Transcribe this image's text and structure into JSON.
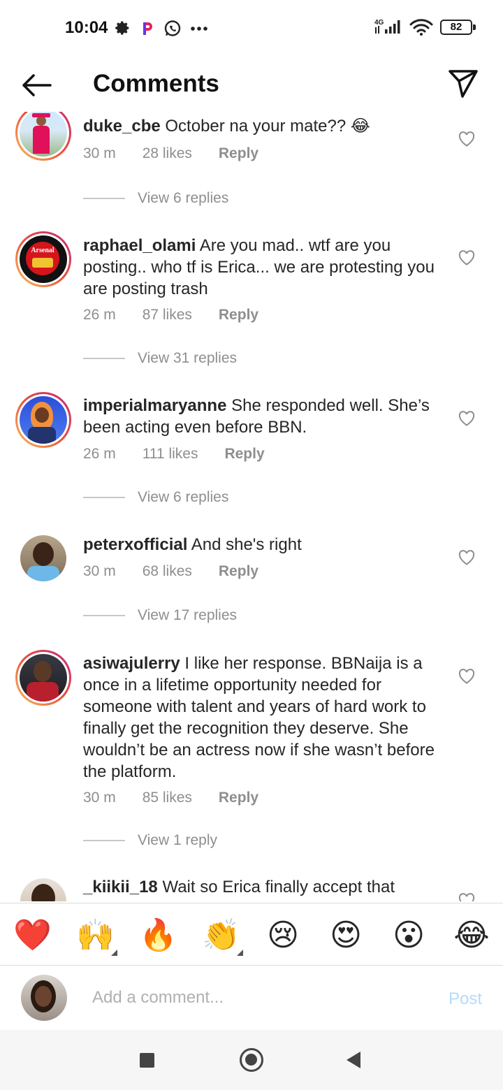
{
  "status_bar": {
    "time": "10:04",
    "network": "4G",
    "battery": "82",
    "left_icons": [
      "gear-icon",
      "p-app-icon",
      "whatsapp-icon",
      "more-dots-icon"
    ],
    "right_icons": [
      "signal-icon",
      "wifi-icon",
      "battery-icon"
    ]
  },
  "header": {
    "title": "Comments",
    "back_icon": "arrow-left-icon",
    "share_icon": "paper-plane-icon"
  },
  "comments": [
    {
      "username": "duke_cbe",
      "text": "October na your mate?? 😂",
      "time": "30 m",
      "likes": "28 likes",
      "reply": "Reply",
      "view_replies": "View 6 replies",
      "story_ring": true
    },
    {
      "username": "raphael_olami",
      "text": "Are you mad.. wtf are you posting.. who tf is Erica... we are protesting you are posting trash",
      "time": "26 m",
      "likes": "87 likes",
      "reply": "Reply",
      "view_replies": "View 31 replies",
      "story_ring": true,
      "avatar_label": "Arsenal"
    },
    {
      "username": "imperialmaryanne",
      "text": "She responded well. She’s been acting even before BBN.",
      "time": "26 m",
      "likes": "111 likes",
      "reply": "Reply",
      "view_replies": "View 6 replies",
      "story_ring": true
    },
    {
      "username": "peterxofficial",
      "text": "And she's right",
      "time": "30 m",
      "likes": "68 likes",
      "reply": "Reply",
      "view_replies": "View 17 replies",
      "story_ring": false
    },
    {
      "username": "asiwajulerry",
      "text": "I like her response. BBNaija is a once in a lifetime opportunity needed for someone with talent and years of hard work to finally get the recognition they deserve. She wouldn’t be an actress now if she wasn’t before the platform.",
      "time": "30 m",
      "likes": "85 likes",
      "reply": "Reply",
      "view_replies": "View 1 reply",
      "story_ring": true
    },
    {
      "username": "_kiikii_18",
      "text": "Wait so Erica finally accept that",
      "story_ring": false
    }
  ],
  "emoji_bar": [
    "❤️",
    "🙌",
    "🔥",
    "👏",
    "😢",
    "😍",
    "😮",
    "😂"
  ],
  "add_comment": {
    "placeholder": "Add a comment...",
    "post_label": "Post",
    "post_color": "#b3dbff"
  },
  "nav_bar": {
    "icons": [
      "recent-apps-icon",
      "home-icon",
      "back-icon"
    ]
  },
  "colors": {
    "text": "#262626",
    "meta": "#8e8e8e",
    "story_ring_start": "#f9c15a",
    "story_ring_end": "#c22a7d"
  }
}
